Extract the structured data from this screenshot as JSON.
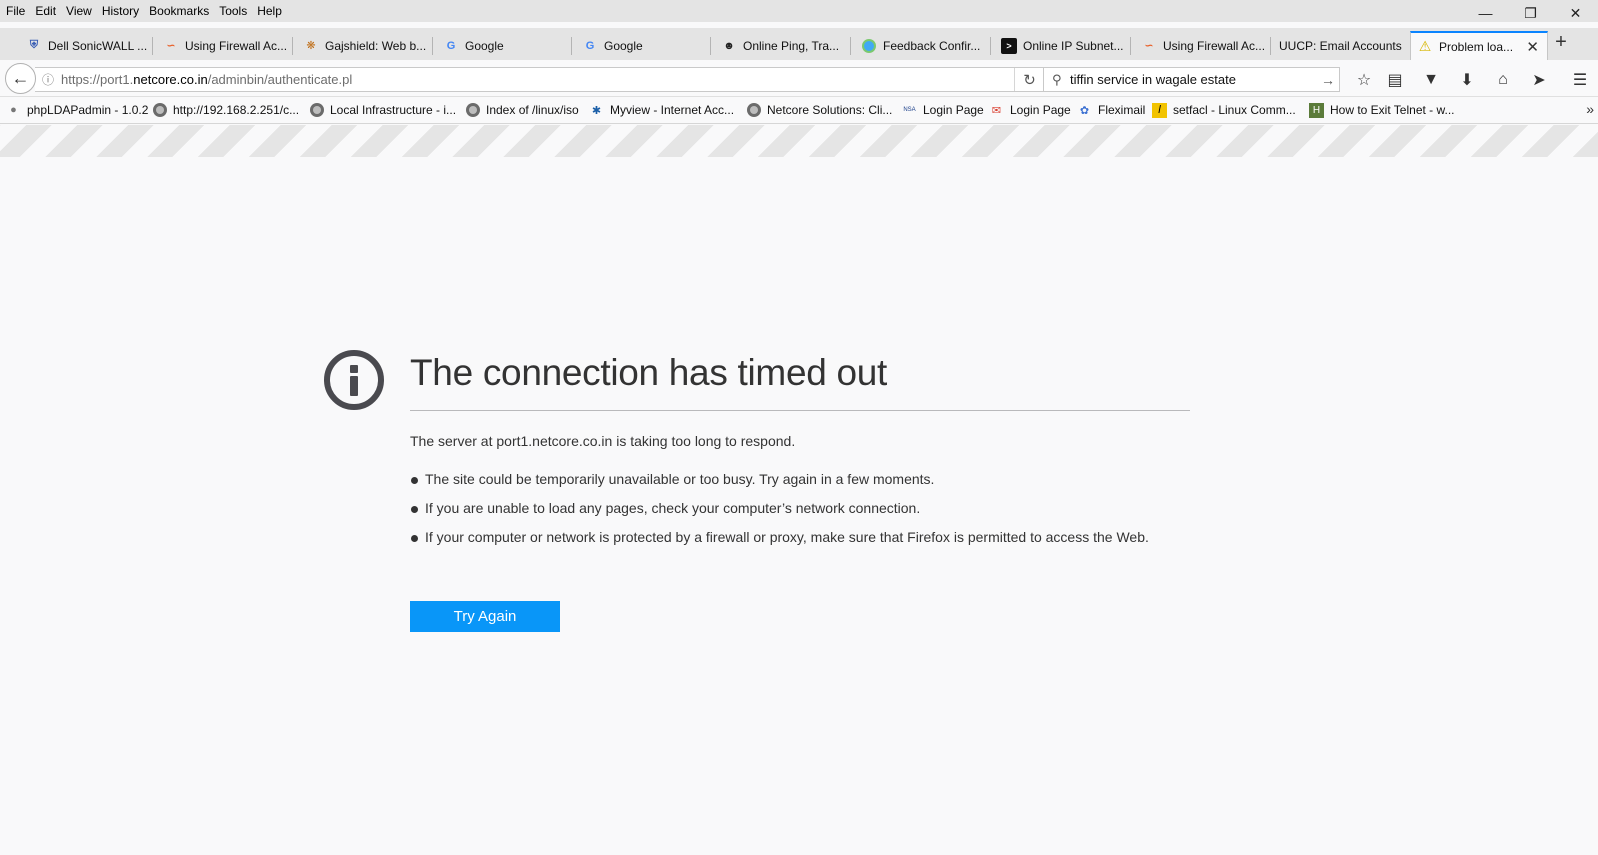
{
  "menubar": {
    "items": [
      "File",
      "Edit",
      "View",
      "History",
      "Bookmarks",
      "Tools",
      "Help"
    ]
  },
  "tabs": [
    {
      "label": "Dell SonicWALL ...",
      "icon": "shield-icon"
    },
    {
      "label": "Using Firewall Ac...",
      "icon": "swoosh-icon"
    },
    {
      "label": "Gajshield: Web b...",
      "icon": "bug-icon"
    },
    {
      "label": "Google",
      "icon": "google-icon"
    },
    {
      "label": "Google",
      "icon": "google-icon"
    },
    {
      "label": "Online Ping, Tra...",
      "icon": "penguin-icon"
    },
    {
      "label": "Feedback Confir...",
      "icon": "globe-icon"
    },
    {
      "label": "Online IP Subnet...",
      "icon": "terminal-icon"
    },
    {
      "label": "Using Firewall Ac...",
      "icon": "swoosh-icon"
    },
    {
      "label": "UUCP: Email Accounts",
      "icon": ""
    },
    {
      "label": "Problem loa...",
      "icon": "warning-icon",
      "active": true
    }
  ],
  "navbar": {
    "url_prefix": "https://port1.",
    "url_domain": "netcore.co.in",
    "url_path": "/adminbin/authenticate.pl",
    "search_value": "tiffin service in wagale estate"
  },
  "bookmarks": [
    {
      "label": "phpLDAPadmin - 1.0.2",
      "icon": "php-icon"
    },
    {
      "label": "http://192.168.2.251/c...",
      "icon": "globe-icon"
    },
    {
      "label": "Local Infrastructure - i...",
      "icon": "globe-icon"
    },
    {
      "label": "Index of /linux/iso",
      "icon": "globe-icon"
    },
    {
      "label": "Myview - Internet Acc...",
      "icon": "tata-icon"
    },
    {
      "label": "Netcore Solutions: Cli...",
      "icon": "globe-icon"
    },
    {
      "label": "Login Page",
      "icon": "nsa-icon"
    },
    {
      "label": "Login Page",
      "icon": "mail-icon"
    },
    {
      "label": "Fleximail",
      "icon": "flexi-icon"
    },
    {
      "label": "setfacl - Linux Comm...",
      "icon": "l-icon"
    },
    {
      "label": "How to Exit Telnet - w...",
      "icon": "h-icon"
    }
  ],
  "error": {
    "title": "The connection has timed out",
    "description": "The server at port1.netcore.co.in is taking too long to respond.",
    "items": [
      "The site could be temporarily unavailable or too busy. Try again in a few moments.",
      "If you are unable to load any pages, check your computer’s network connection.",
      "If your computer or network is protected by a firewall or proxy, make sure that Firefox is permitted to access the Web."
    ],
    "button_label": "Try Again"
  },
  "colors": {
    "accent": "#0996f8",
    "tab_highlight": "#0a84ff",
    "chrome_bg": "#e4e4e4",
    "page_bg": "#f9f9fa"
  }
}
